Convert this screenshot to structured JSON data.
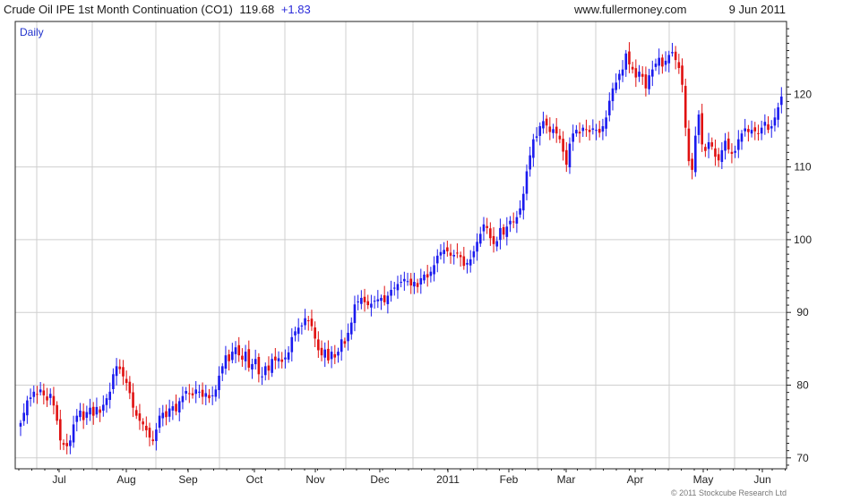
{
  "header": {
    "instrument": "Crude Oil IPE 1st Month Continuation (CO1)",
    "last": "119.68",
    "change": "+1.83",
    "site": "www.fullermoney.com",
    "date": "9 Jun 2011"
  },
  "period_label": "Daily",
  "copyright": "© 2011 Stockcube Research Ltd",
  "colors": {
    "up": "#1a1aee",
    "down": "#e01010",
    "grid": "#cfcfcf",
    "frame": "#222222"
  },
  "chart_data": {
    "type": "candlestick",
    "y_axis": {
      "side": "right",
      "ylim": [
        68.5,
        130
      ],
      "ticks": [
        70,
        80,
        90,
        100,
        110,
        120
      ]
    },
    "x_tick_labels": [
      "Jul",
      "Aug",
      "Sep",
      "Oct",
      "Nov",
      "Dec",
      "2011",
      "Feb",
      "Mar",
      "Apr",
      "May",
      "Jun"
    ],
    "grid": true,
    "closes": [
      74.8,
      76.2,
      77.9,
      78.3,
      79.1,
      78.7,
      79.4,
      78.6,
      77.9,
      78.8,
      77.2,
      75.1,
      72.4,
      71.8,
      71.6,
      72.4,
      74.6,
      75.8,
      76.5,
      75.2,
      76.3,
      76.9,
      75.8,
      77.0,
      76.2,
      77.3,
      78.2,
      79.1,
      81.5,
      82.6,
      82.2,
      81.2,
      80.3,
      78.9,
      76.9,
      75.8,
      75.1,
      74.6,
      73.8,
      72.8,
      72.3,
      73.9,
      75.8,
      76.2,
      75.6,
      76.8,
      77.1,
      76.4,
      77.8,
      78.5,
      79.2,
      78.8,
      78.6,
      79.4,
      79.1,
      78.4,
      78.9,
      78.2,
      78.6,
      79.4,
      81.3,
      82.6,
      84.1,
      83.3,
      84.6,
      85.2,
      84.1,
      83.5,
      84.6,
      82.4,
      82.9,
      83.6,
      81.5,
      81.2,
      82.6,
      82.0,
      83.6,
      83.4,
      83.7,
      83.2,
      83.8,
      84.5,
      86.6,
      87.4,
      87.9,
      88.2,
      89.2,
      88.8,
      88.1,
      86.4,
      84.8,
      84.1,
      84.9,
      83.4,
      84.6,
      83.8,
      84.6,
      86.3,
      85.7,
      87.2,
      88.6,
      91.1,
      91.5,
      92.0,
      91.4,
      91.0,
      91.2,
      91.6,
      91.8,
      92.0,
      91.4,
      92.3,
      93.1,
      93.4,
      93.9,
      94.2,
      94.6,
      94.3,
      93.7,
      94.2,
      93.5,
      94.7,
      95.2,
      94.8,
      95.6,
      96.5,
      97.8,
      98.3,
      98.6,
      98.4,
      97.8,
      97.9,
      98.2,
      97.6,
      96.4,
      96.8,
      97.3,
      98.4,
      99.7,
      100.8,
      102.1,
      101.6,
      100.2,
      99.4,
      99.8,
      101.6,
      100.7,
      101.8,
      102.6,
      102.4,
      103.1,
      104.3,
      106.3,
      109.4,
      111.6,
      113.8,
      114.2,
      115.6,
      116.3,
      115.7,
      114.8,
      115.2,
      114.6,
      113.8,
      112.1,
      110.3,
      113.2,
      114.6,
      115.1,
      114.6,
      115.4,
      115.2,
      114.8,
      115.3,
      115.1,
      114.7,
      115.6,
      116.8,
      119.1,
      120.8,
      121.6,
      122.8,
      123.4,
      125.6,
      124.1,
      123.4,
      122.3,
      123.1,
      122.4,
      120.8,
      122.6,
      123.4,
      124.2,
      125.0,
      123.8,
      124.6,
      125.4,
      125.8,
      124.7,
      123.6,
      121.3,
      115.4,
      110.8,
      109.6,
      114.3,
      117.2,
      113.1,
      112.2,
      113.4,
      112.8,
      111.4,
      110.9,
      112.3,
      113.6,
      112.4,
      111.8,
      112.2,
      113.8,
      114.6,
      115.3,
      114.8,
      115.1,
      114.9,
      114.6,
      115.4,
      116.2,
      115.1,
      115.6,
      116.8,
      118.2,
      119.68
    ]
  }
}
